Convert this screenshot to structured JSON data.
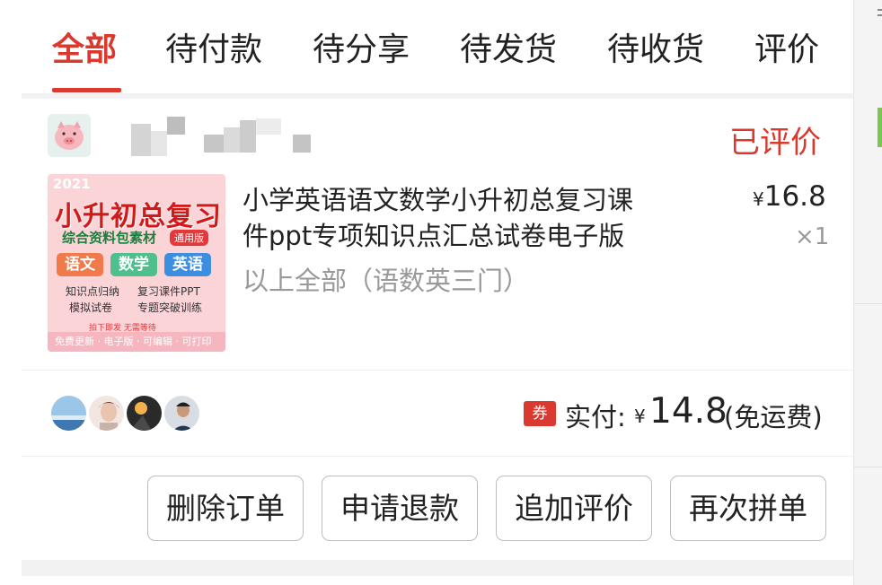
{
  "tabs": [
    {
      "label": "全部",
      "active": true
    },
    {
      "label": "待付款",
      "active": false
    },
    {
      "label": "待分享",
      "active": false
    },
    {
      "label": "待发货",
      "active": false
    },
    {
      "label": "待收货",
      "active": false
    },
    {
      "label": "评价",
      "active": false
    }
  ],
  "order": {
    "status": "已评价",
    "product": {
      "title_line1": "小学英语语文数学小升初总复习课",
      "title_line2": "件ppt专项知识点汇总试卷电子版",
      "spec": "以上全部（语数英三门）",
      "price_symbol": "¥",
      "price": "16.8",
      "quantity": "×1",
      "image": {
        "year": "2021",
        "title": "小升初总复习",
        "subtitle": "综合资料包素材",
        "tag": "通用版",
        "subjects": [
          "语文",
          "数学",
          "英语"
        ],
        "lines": [
          "知识点归纳",
          "复习课件PPT",
          "模拟试卷",
          "专题突破训练"
        ],
        "small_note": "拍下即发 无需等待",
        "bottom": "免费更新 · 电子版 · 可编辑 · 可打印"
      }
    },
    "payment": {
      "coupon_label": "券",
      "paid_label": "实付:",
      "currency": "¥",
      "amount": "14.8",
      "note": "(免运费)"
    },
    "actions": {
      "delete": "删除订单",
      "refund": "申请退款",
      "review": "追加评价",
      "regroup": "再次拼单"
    }
  },
  "colors": {
    "accent": "#d9392e",
    "muted_text": "#999999",
    "separator": "#f2f2f2"
  },
  "icons": {
    "seller_avatar": "pig-avatar-icon",
    "coupon": "coupon-icon"
  }
}
